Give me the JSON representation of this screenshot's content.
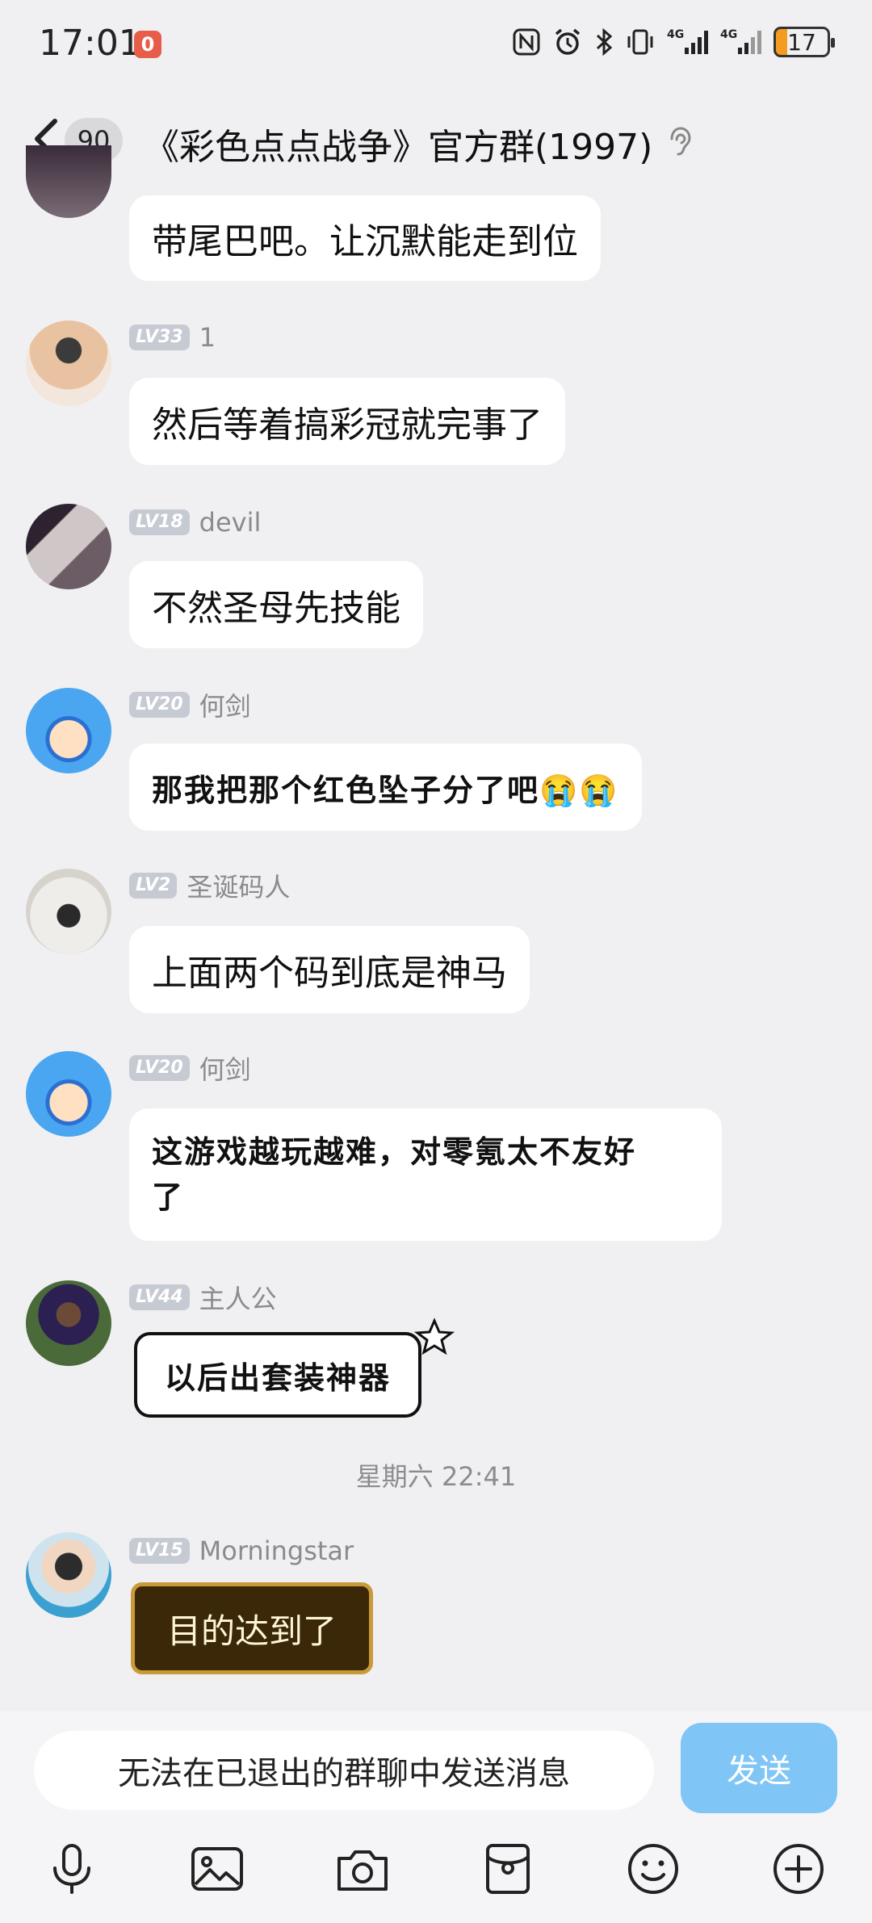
{
  "status_bar": {
    "time": "17:01",
    "notification_badge": "0",
    "battery": "17",
    "icons": [
      "nfc-icon",
      "alarm-icon",
      "bluetooth-icon",
      "vibrate-icon",
      "signal-4g-icon",
      "signal-4g-icon",
      "battery-icon"
    ]
  },
  "header": {
    "unread_count": "90",
    "title": "《彩色点点战争》官方群(1997)"
  },
  "messages": [
    {
      "level": "",
      "name": "",
      "text": "带尾巴吧。让沉默能走到位"
    },
    {
      "level": "LV33",
      "name": "1",
      "text": "然后等着搞彩冠就完事了"
    },
    {
      "level": "LV18",
      "name": "devil",
      "text": "不然圣母先技能"
    },
    {
      "level": "LV20",
      "name": "何剑",
      "text": "那我把那个红色坠子分了吧😭😭"
    },
    {
      "level": "LV2",
      "name": "圣诞码人",
      "text": "上面两个码到底是神马"
    },
    {
      "level": "LV20",
      "name": "何剑",
      "text": "这游戏越玩越难，对零氪太不友好",
      "text2": "了"
    },
    {
      "level": "LV44",
      "name": "主人公",
      "text": "以后出套装神器"
    },
    {
      "level": "LV15",
      "name": "Morningstar",
      "text": "目的达到了"
    }
  ],
  "timestamp": "星期六 22:41",
  "input": {
    "placeholder": "无法在已退出的群聊中发送消息",
    "send_label": "发送"
  },
  "colors": {
    "background": "#f0f0f2",
    "send_button": "#7fc6f7",
    "level_badge": "#c6cad3",
    "nickname": "#8a8a8f"
  }
}
